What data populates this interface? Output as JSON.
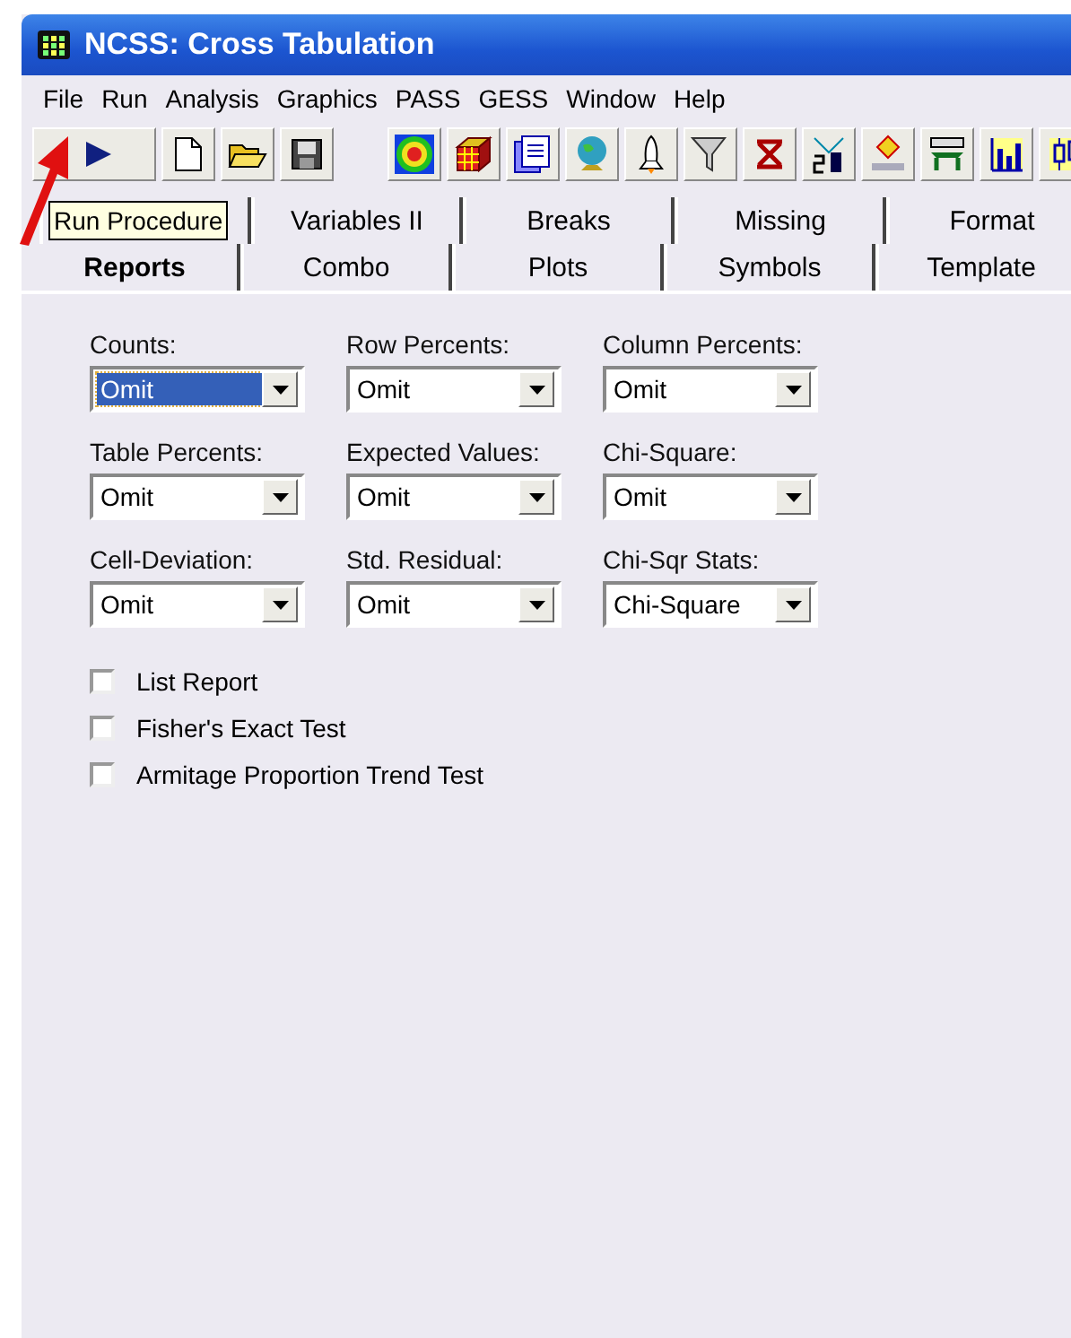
{
  "window": {
    "title": "NCSS: Cross Tabulation"
  },
  "menu": [
    "File",
    "Run",
    "Analysis",
    "Graphics",
    "PASS",
    "GESS",
    "Window",
    "Help"
  ],
  "tooltip": "Run Procedure",
  "tab_rows": [
    [
      {
        "selected": false
      },
      {
        "label": "Variables II",
        "selected": false
      },
      {
        "label": "Breaks",
        "selected": false
      },
      {
        "label": "Missing",
        "selected": false
      },
      {
        "label": "Format",
        "selected": false
      }
    ],
    [
      {
        "label": "Reports",
        "selected": true
      },
      {
        "label": "Combo",
        "selected": false
      },
      {
        "label": "Plots",
        "selected": false
      },
      {
        "label": "Symbols",
        "selected": false
      },
      {
        "label": "Template",
        "selected": false
      }
    ]
  ],
  "dropdowns": [
    {
      "label": "Counts:",
      "value": "Omit",
      "focused": true
    },
    {
      "label": "Row Percents:",
      "value": "Omit",
      "focused": false
    },
    {
      "label": "Column Percents:",
      "value": "Omit",
      "focused": false
    },
    {
      "label": "Table Percents:",
      "value": "Omit",
      "focused": false
    },
    {
      "label": "Expected Values:",
      "value": "Omit",
      "focused": false
    },
    {
      "label": "Chi-Square:",
      "value": "Omit",
      "focused": false
    },
    {
      "label": "Cell-Deviation:",
      "value": "Omit",
      "focused": false
    },
    {
      "label": "Std. Residual:",
      "value": "Omit",
      "focused": false
    },
    {
      "label": "Chi-Sqr Stats:",
      "value": "Chi-Square",
      "focused": false
    }
  ],
  "checkboxes": [
    {
      "label": "List Report",
      "checked": false
    },
    {
      "label": "Fisher's Exact Test",
      "checked": false
    },
    {
      "label": "Armitage Proportion Trend Test",
      "checked": false
    }
  ]
}
